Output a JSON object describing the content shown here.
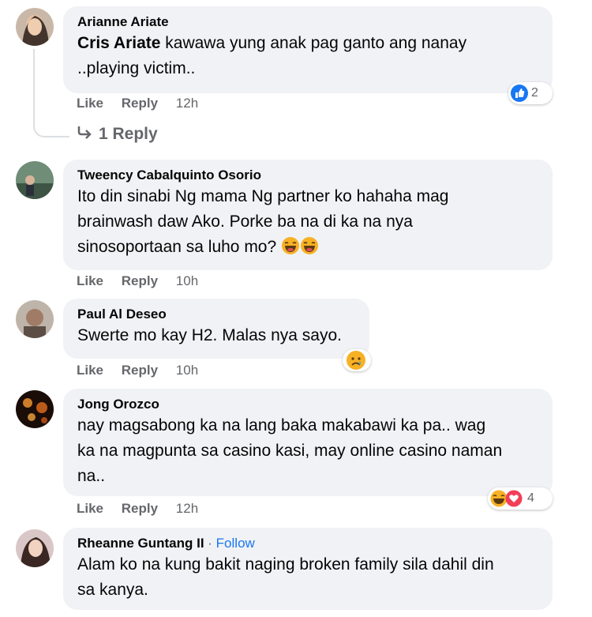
{
  "comments": [
    {
      "author": "Arianne Ariate",
      "mention": "Cris Ariate",
      "text_line1": " kawawa yung anak pag ganto ang nanay",
      "text_line2": "..playing victim..",
      "like": "Like",
      "reply": "Reply",
      "time": "12h",
      "reaction_count": "2",
      "replies_link": "1 Reply"
    },
    {
      "author": "Tweency Cabalquinto Osorio",
      "text_lines": [
        "Ito din sinabi Ng mama Ng partner ko hahaha mag",
        "brainwash daw Ako. Porke ba na di ka na nya",
        "sinosoportaan sa luho mo?"
      ],
      "like": "Like",
      "reply": "Reply",
      "time": "10h"
    },
    {
      "author": "Paul Al Deseo",
      "text_lines": [
        "Swerte mo kay H2. Malas nya sayo."
      ],
      "like": "Like",
      "reply": "Reply",
      "time": "10h"
    },
    {
      "author": "Jong Orozco",
      "text_lines": [
        "nay magsabong ka na lang baka makabawi ka pa.. wag",
        "ka na magpunta sa casino kasi, may online casino naman",
        "na.."
      ],
      "like": "Like",
      "reply": "Reply",
      "time": "12h",
      "reaction_count": "4"
    },
    {
      "author": "Rheanne Guntang II",
      "separator": " · ",
      "follow": "Follow",
      "text_lines": [
        "Alam ko na kung bakit naging broken family sila dahil din",
        "sa kanya."
      ]
    }
  ],
  "colors": {
    "bubble": "#f0f2f5",
    "secondary": "#65676b",
    "link": "#1877f2",
    "like_blue": "#1877f2",
    "love_red": "#f33e58"
  }
}
